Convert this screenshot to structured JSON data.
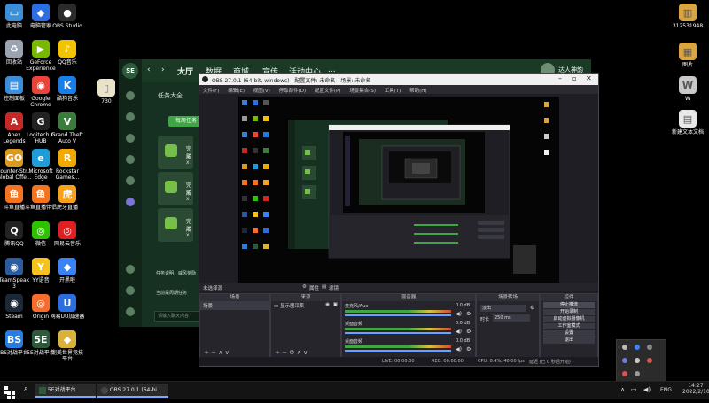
{
  "desktop": {
    "icons_left": [
      {
        "label": "此电脑",
        "icon": "computer-icon",
        "color": "#3c8fd6",
        "glyph": "▭"
      },
      {
        "label": "电脑管家",
        "icon": "shield-icon",
        "color": "#2b6fe0",
        "glyph": "◆"
      },
      {
        "label": "OBS Studio",
        "icon": "obs-icon",
        "color": "#2b2b2b",
        "glyph": "●"
      },
      {
        "label": "回收站",
        "icon": "recycle-bin-icon",
        "color": "#9aa4b0",
        "glyph": "♻"
      },
      {
        "label": "GeForce Experience",
        "icon": "geforce-icon",
        "color": "#76b900",
        "glyph": "▶"
      },
      {
        "label": "QQ音乐",
        "icon": "qq-music-icon",
        "color": "#f2c300",
        "glyph": "♪"
      },
      {
        "label": "控制面板",
        "icon": "control-panel-icon",
        "color": "#3b8ed8",
        "glyph": "▤"
      },
      {
        "label": "Google Chrome",
        "icon": "chrome-icon",
        "color": "#e8443a",
        "glyph": "◉"
      },
      {
        "label": "酷狗音乐",
        "icon": "kugou-icon",
        "color": "#1a7ee8",
        "glyph": "K"
      },
      {
        "label": "Apex Legends",
        "icon": "apex-icon",
        "color": "#c62828",
        "glyph": "A"
      },
      {
        "label": "Logitech G HUB",
        "icon": "logitech-icon",
        "color": "#222",
        "glyph": "G"
      },
      {
        "label": "Grand Theft Auto V",
        "icon": "gta-icon",
        "color": "#3a7d3a",
        "glyph": "V"
      },
      {
        "label": "Counter-Str... Global Offe...",
        "icon": "csgo-icon",
        "color": "#d99a1e",
        "glyph": "GO"
      },
      {
        "label": "Microsoft Edge",
        "icon": "edge-icon",
        "color": "#1e9dd8",
        "glyph": "e"
      },
      {
        "label": "Rockstar Games...",
        "icon": "rockstar-icon",
        "color": "#f2a900",
        "glyph": "R"
      },
      {
        "label": "斗鱼直播",
        "icon": "douyu-icon",
        "color": "#f5731f",
        "glyph": "鱼"
      },
      {
        "label": "斗鱼直播伴侣",
        "icon": "douyu-companion-icon",
        "color": "#f5731f",
        "glyph": "鱼"
      },
      {
        "label": "虎牙直播",
        "icon": "huya-icon",
        "color": "#f7a11a",
        "glyph": "虎"
      },
      {
        "label": "腾讯QQ",
        "icon": "qq-icon",
        "color": "#222",
        "glyph": "Q"
      },
      {
        "label": "微信",
        "icon": "wechat-icon",
        "color": "#2dc100",
        "glyph": "◎"
      },
      {
        "label": "网易云音乐",
        "icon": "netease-music-icon",
        "color": "#e02020",
        "glyph": "◎"
      },
      {
        "label": "TeamSpeak 3",
        "icon": "teamspeak-icon",
        "color": "#2b5c9e",
        "glyph": "◉"
      },
      {
        "label": "YY语音",
        "icon": "yy-icon",
        "color": "#f6c21c",
        "glyph": "Y"
      },
      {
        "label": "开黑啦",
        "icon": "kaiheila-icon",
        "color": "#3b82f6",
        "glyph": "◆"
      },
      {
        "label": "Steam",
        "icon": "steam-icon",
        "color": "#1b2838",
        "glyph": "◉"
      },
      {
        "label": "Origin",
        "icon": "origin-icon",
        "color": "#f56c2d",
        "glyph": "◎"
      },
      {
        "label": "网易UU加速器",
        "icon": "uu-icon",
        "color": "#2a6ee0",
        "glyph": "U"
      },
      {
        "label": "BS对战平台",
        "icon": "bs-platform-icon",
        "color": "#2a7de0",
        "glyph": "BS"
      },
      {
        "label": "5E对战平台",
        "icon": "5e-platform-icon",
        "color": "#2e5a3c",
        "glyph": "5E"
      },
      {
        "label": "完美世界竞技平台",
        "icon": "perfect-world-icon",
        "color": "#d8b23a",
        "glyph": "◆"
      }
    ],
    "folder_label": "730",
    "icons_right": [
      {
        "label": "312531948",
        "icon": "zip-archive-icon",
        "color": "#d9a441",
        "glyph": "▥"
      },
      {
        "label": "图片",
        "icon": "picture-folder-icon",
        "color": "#d9a441",
        "glyph": "▦"
      },
      {
        "label": "W",
        "icon": "word-doc-icon",
        "color": "#c9c9c9",
        "glyph": "W"
      },
      {
        "label": "新建文本文档",
        "icon": "text-doc-icon",
        "color": "#e9e9e9",
        "glyph": "▤"
      }
    ]
  },
  "se_app": {
    "logo": "SE",
    "tabs": [
      "大厅",
      "数据",
      "商城",
      "宣传",
      "活动中心",
      "..."
    ],
    "username": "达人神韵",
    "section_title": "任务大全",
    "task_tab": "每周任务",
    "tasks": [
      {
        "title": "完成",
        "sub": "5 x"
      },
      {
        "title": "完成",
        "sub": "5 x"
      },
      {
        "title": "完成",
        "sub": "2 x"
      }
    ],
    "notice_line1": "任务说明，威风奖励",
    "notice_line2": "当前是周期任务",
    "input_placeholder": "请输入聊天内容"
  },
  "obs": {
    "title": "OBS 27.0.1 (64-bit, windows) - 配置文件: 未命名 - 场景: 未命名",
    "menu": [
      "文件(F)",
      "编辑(E)",
      "视图(V)",
      "停靠部件(D)",
      "配置文件(P)",
      "场景集合(S)",
      "工具(T)",
      "帮助(H)"
    ],
    "source_bar_label": "未选择源",
    "source_bar_props": "属性",
    "source_bar_filters": "滤镜",
    "docks": {
      "scenes": {
        "header": "场景",
        "items": [
          "场景"
        ]
      },
      "sources": {
        "header": "来源",
        "items": [
          "显示器采集"
        ]
      },
      "mixer": {
        "header": "混音器",
        "channels": [
          {
            "name": "麦克风/Aux",
            "db": "0.0 dB"
          },
          {
            "name": "桌面音频",
            "db": "0.0 dB"
          },
          {
            "name": "桌面音频",
            "db": "0.0 dB"
          }
        ]
      },
      "transitions": {
        "header": "场景转场",
        "type": "淡出",
        "duration_label": "时长",
        "duration": "250 ms"
      },
      "controls": {
        "header": "控件",
        "buttons": [
          "停止推流",
          "开始录制",
          "启动虚拟摄像机",
          "工作室模式",
          "设置",
          "退出"
        ]
      }
    },
    "status": {
      "live": "LIVE: 00:00:00",
      "rec": "REC: 00:00:00",
      "cpu": "CPU: 0.4%, 40.00 fps",
      "connection": "延迟 (已 0 秒后开始)"
    }
  },
  "taskbar": {
    "search_icon": "search-icon",
    "apps": [
      {
        "label": "5E对战平台",
        "icon": "5e-platform-icon"
      },
      {
        "label": "OBS 27.0.1 (64-bi...",
        "icon": "obs-icon"
      }
    ],
    "lang": "ENG",
    "time": "14:27",
    "date": "2022/2/10"
  },
  "tray_popup": {
    "icons": [
      "usb-icon",
      "bluetooth-icon",
      "network-icon",
      "shield-icon",
      "record-icon",
      "chevron-icon",
      "arrow-icon",
      "obs-tray-icon",
      "steam-tray-icon"
    ]
  },
  "colors": {
    "se_green": "#3fa645",
    "obs_bg": "#1e1e24",
    "accent_blue": "#7aa7ff"
  }
}
